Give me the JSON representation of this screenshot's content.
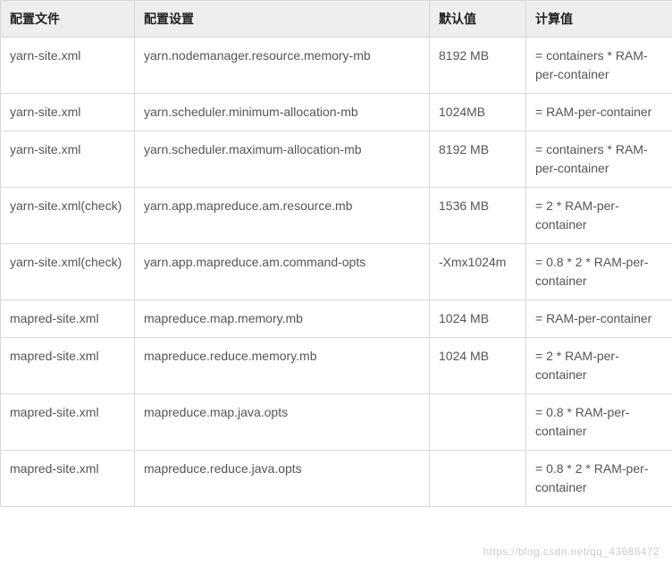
{
  "headers": {
    "col1": "配置文件",
    "col2": "配置设置",
    "col3": "默认值",
    "col4": "计算值"
  },
  "rows": [
    {
      "file": "yarn-site.xml",
      "setting": "yarn.nodemanager.resource.memory-mb",
      "default": "8192 MB",
      "calc": "= containers * RAM-per-container"
    },
    {
      "file": "yarn-site.xml",
      "setting": "yarn.scheduler.minimum-allocation-mb",
      "default": "1024MB",
      "calc": "= RAM-per-container"
    },
    {
      "file": "yarn-site.xml",
      "setting": "yarn.scheduler.maximum-allocation-mb",
      "default": "8192 MB",
      "calc": "= containers * RAM-per-container"
    },
    {
      "file": "yarn-site.xml(check)",
      "setting": "yarn.app.mapreduce.am.resource.mb",
      "default": "1536 MB",
      "calc": "= 2 * RAM-per-container"
    },
    {
      "file": "yarn-site.xml(check)",
      "setting": "yarn.app.mapreduce.am.command-opts",
      "default": "-Xmx1024m",
      "calc": "= 0.8 * 2 * RAM-per-container"
    },
    {
      "file": "mapred-site.xml",
      "setting": "mapreduce.map.memory.mb",
      "default": "1024 MB",
      "calc": "= RAM-per-container"
    },
    {
      "file": "mapred-site.xml",
      "setting": "mapreduce.reduce.memory.mb",
      "default": "1024 MB",
      "calc": "= 2 * RAM-per-container"
    },
    {
      "file": "mapred-site.xml",
      "setting": "mapreduce.map.java.opts",
      "default": "",
      "calc": "= 0.8 * RAM-per-container"
    },
    {
      "file": "mapred-site.xml",
      "setting": "mapreduce.reduce.java.opts",
      "default": "",
      "calc": "= 0.8 * 2 * RAM-per-container"
    }
  ],
  "watermark": "https://blog.csdn.net/qq_43688472"
}
